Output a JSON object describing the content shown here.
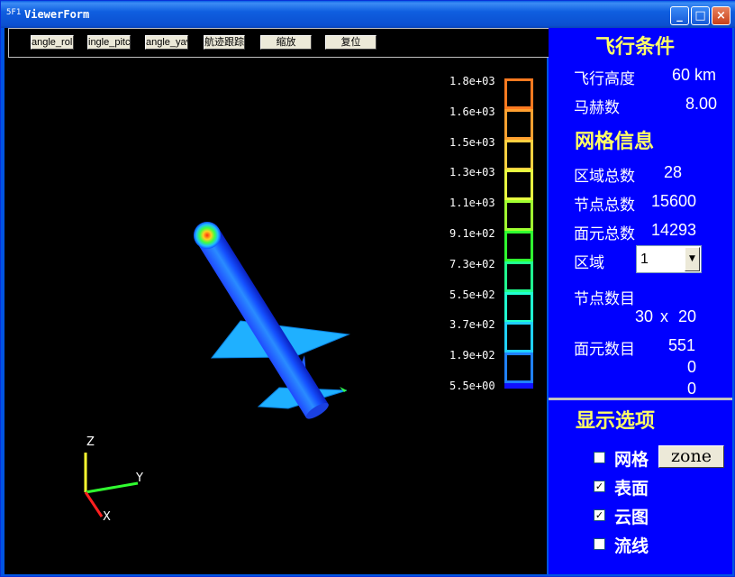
{
  "window": {
    "title": "ViewerForm",
    "app_icon_text": "5F1",
    "minimize_glyph": "_",
    "maximize_glyph": "□",
    "close_glyph": "×"
  },
  "toolbar": {
    "buttons": [
      {
        "label": "angle_roll"
      },
      {
        "label": "ingle_pitc"
      },
      {
        "label": "angle_yav"
      },
      {
        "label": "航迹跟踪"
      },
      {
        "label": "缩放"
      },
      {
        "label": "复位"
      }
    ]
  },
  "legend": {
    "labels": [
      "1.8e+03",
      "1.6e+03",
      "1.5e+03",
      "1.3e+03",
      "1.1e+03",
      "9.1e+02",
      "7.3e+02",
      "5.5e+02",
      "3.7e+02",
      "1.9e+02",
      "5.5e+00"
    ],
    "colors": [
      "#ff7a20",
      "#ffa030",
      "#ffd040",
      "#e8ff40",
      "#a0ff30",
      "#30ff30",
      "#20ff90",
      "#20ffd0",
      "#20d0ff",
      "#2080ff",
      "#1010ff"
    ]
  },
  "axes": {
    "x": "X",
    "y": "Y",
    "z": "Z"
  },
  "flight": {
    "title": "飞行条件",
    "altitude_label": "飞行高度",
    "altitude_value": "60 km",
    "mach_label": "马赫数",
    "mach_value": "8.00"
  },
  "mesh": {
    "title": "网格信息",
    "zones_label": "区域总数",
    "zones_value": "28",
    "nodes_label": "节点总数",
    "nodes_value": "15600",
    "faces_label": "面元总数",
    "faces_value": "14293",
    "zone_label": "区域",
    "zone_selected": "1",
    "node_count_label": "节点数目",
    "node_count_a": "30",
    "node_count_x": "x",
    "node_count_b": "20",
    "face_count_label": "面元数目",
    "face_count_values": [
      "551",
      "0",
      "0"
    ]
  },
  "display": {
    "title": "显示选项",
    "options": [
      {
        "label": "网格",
        "checked": false
      },
      {
        "label": "表面",
        "checked": true
      },
      {
        "label": "云图",
        "checked": true
      },
      {
        "label": "流线",
        "checked": false
      }
    ],
    "zone_button": "zone"
  }
}
